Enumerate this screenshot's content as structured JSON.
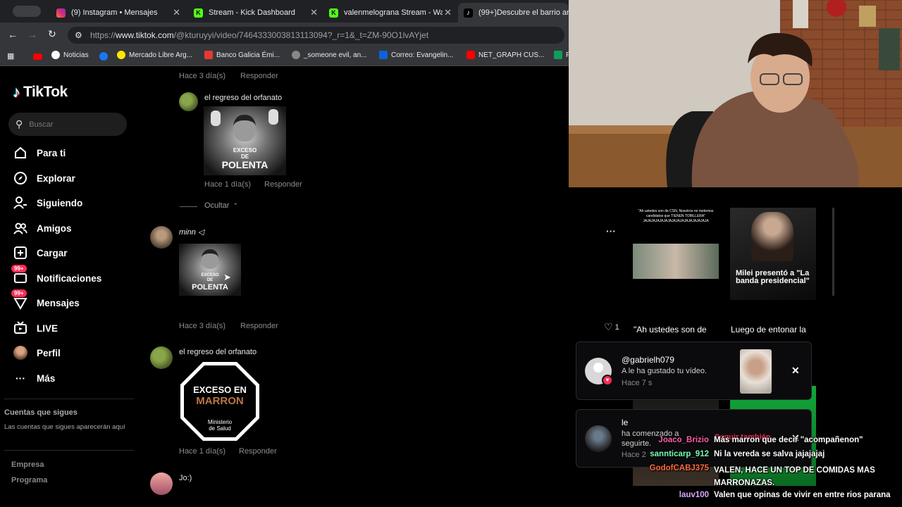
{
  "tabs": [
    {
      "label": "(9) Instagram • Mensajes"
    },
    {
      "label": "Stream - Kick Dashboard"
    },
    {
      "label": "valenmelograna Stream - Wat"
    },
    {
      "label": "(99+)Descubre el barrio arge"
    }
  ],
  "address": {
    "url_prefix": "https://",
    "url_host": "www.tiktok.com",
    "url_path": "/@kturuyyi/video/7464333003813113094?_r=1&_t=ZM-90O1lvAYjet"
  },
  "bookmarks": [
    {
      "label": "Noticias"
    },
    {
      "label": "Mercado Libre Arg..."
    },
    {
      "label": "Banco Galicia Émi..."
    },
    {
      "label": "_someone evil, an..."
    },
    {
      "label": "Correo: Evangelin..."
    },
    {
      "label": "NET_GRAPH CUS..."
    },
    {
      "label": "F"
    }
  ],
  "tiktok": {
    "logo": "TikTok",
    "search_placeholder": "Buscar",
    "nav": [
      {
        "label": "Para ti"
      },
      {
        "label": "Explorar"
      },
      {
        "label": "Siguiendo"
      },
      {
        "label": "Amigos"
      },
      {
        "label": "Cargar"
      },
      {
        "label": "Notificaciones",
        "badge": "99+"
      },
      {
        "label": "Mensajes",
        "badge": "99+"
      },
      {
        "label": "LIVE"
      },
      {
        "label": "Perfil"
      },
      {
        "label": "Más"
      }
    ],
    "following_title": "Cuentas que sigues",
    "following_desc": "Las cuentas que sigues aparecerán aquí",
    "footer": [
      "Empresa",
      "Programa"
    ]
  },
  "comments": {
    "top_time": "Hace 3 día(s)",
    "reply_label": "Responder",
    "c1": {
      "name": "el regreso del orfanato",
      "img_line1": "EXCESO",
      "img_line2": "DE",
      "img_line3": "POLENTA",
      "time": "Hace 1 día(s)"
    },
    "hide_label": "Ocultar",
    "c2": {
      "name": "minn ◁",
      "img_line1": "EXCESO",
      "img_line2": "DE",
      "img_line3": "POLENTA",
      "time": "Hace 3 día(s)"
    },
    "c3": {
      "name": "el regreso del orfanato",
      "img_line1": "EXCESO EN",
      "img_line2": "MARRON",
      "img_line3": "Ministerio",
      "img_line4": "de Salud",
      "time": "Hace 1 día(s)"
    },
    "c4": {
      "name": "Jo:)"
    }
  },
  "related": {
    "card1_meme": "\"Ah ustedes son de CSN, Nosotros no metemos candidatos que TIENEN TOBILLERA\" JAJAJAJAJAJAJAJAJAJAJAJAJAJAJAJA",
    "card2_caption": "Milei presentó a \"La banda presidencial\"",
    "likes": "1",
    "desc1": "\"Ah ustedes son de",
    "desc2": "Luego de entonar la"
  },
  "notifications": [
    {
      "user": "@gabrielh079",
      "text": "A le ha gustado tu vídeo.",
      "time": "Hace 7 s"
    },
    {
      "user": "le",
      "text": "ha comenzado a seguirte.",
      "time": "Hace 2",
      "action": "Seguir también"
    }
  ],
  "chat": [
    {
      "user": "Joaco_Brizio",
      "msg": "Más marron que decir \"acompañenon\"",
      "color": "#ff5ea8"
    },
    {
      "user": "sannticarp_912",
      "msg": "Ni la vereda se salva jajajajaj",
      "color": "#7bffb4"
    },
    {
      "user": "GodofCABJ375",
      "msg": "VALEN, HACE UN TOP DE COMIDAS MAS MARRONAZAS.",
      "color": "#ff6b3d"
    },
    {
      "user": "lauv100",
      "msg": "Valen que opinas de vivir en entre rios parana",
      "color": "#d8a8ff"
    }
  ]
}
